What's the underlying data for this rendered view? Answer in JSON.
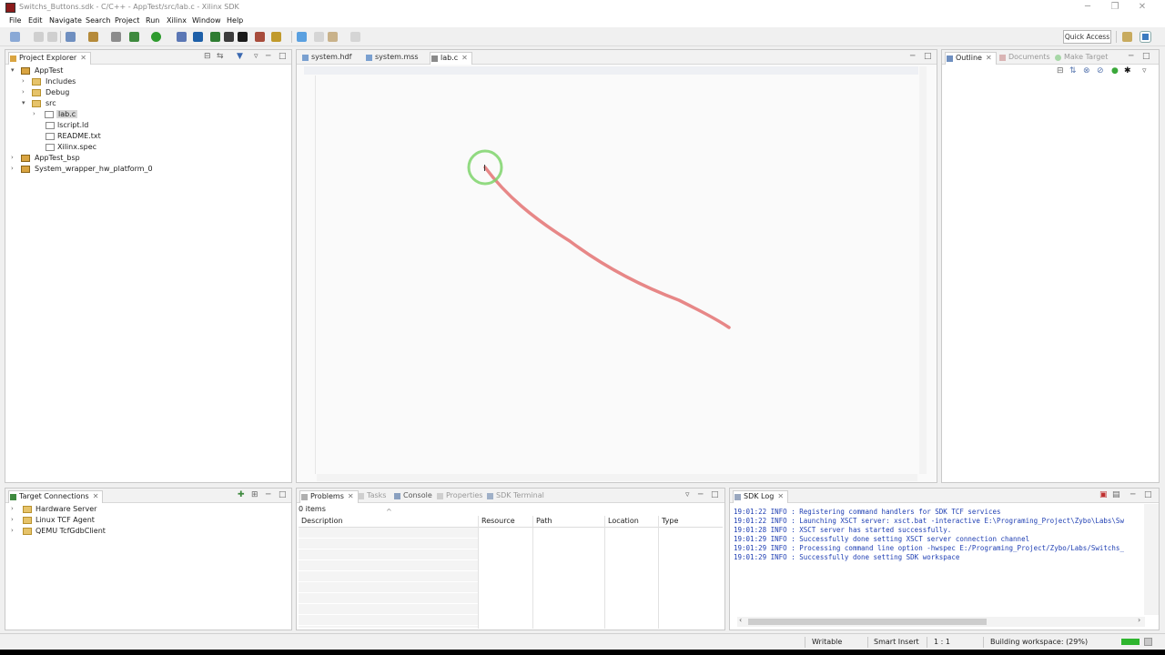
{
  "window": {
    "title": "Switchs_Buttons.sdk - C/C++ - AppTest/src/lab.c - Xilinx SDK",
    "controls": [
      "─",
      "❐",
      "✕"
    ]
  },
  "menu": [
    "File",
    "Edit",
    "Navigate",
    "Search",
    "Project",
    "Run",
    "Xilinx",
    "Window",
    "Help"
  ],
  "toolbar": {
    "quick_access": "Quick Access"
  },
  "project_explorer": {
    "title": "Project Explorer",
    "tree": {
      "apptest": "AppTest",
      "includes": "Includes",
      "debug": "Debug",
      "src": "src",
      "lab_c": "lab.c",
      "lscript": "lscript.ld",
      "readme": "README.txt",
      "xilinx_spec": "Xilinx.spec",
      "bsp": "AppTest_bsp",
      "hw_platform": "System_wrapper_hw_platform_0"
    }
  },
  "editor": {
    "tabs": [
      "system.hdf",
      "system.mss",
      "lab.c"
    ],
    "active_tab": "lab.c"
  },
  "outline": {
    "tabs": [
      "Outline",
      "Documents",
      "Make Target"
    ]
  },
  "target_connections": {
    "title": "Target Connections",
    "items": [
      "Hardware Server",
      "Linux TCF Agent",
      "QEMU TcfGdbClient"
    ]
  },
  "problems": {
    "tabs": [
      "Problems",
      "Tasks",
      "Console",
      "Properties",
      "SDK Terminal"
    ],
    "count": "0 items",
    "columns": [
      "Description",
      "Resource",
      "Path",
      "Location",
      "Type"
    ]
  },
  "sdk_log": {
    "title": "SDK Log",
    "lines": [
      "19:01:22 INFO   : Registering command handlers for SDK TCF services",
      "19:01:22 INFO   : Launching XSCT server: xsct.bat -interactive E:\\Programing_Project\\Zybo\\Labs\\Sw",
      "19:01:28 INFO   : XSCT server has started successfully.",
      "19:01:29 INFO   : Successfully done setting XSCT server connection channel",
      "19:01:29 INFO   : Processing command line option -hwspec E:/Programing_Project/Zybo/Labs/Switchs_",
      "19:01:29 INFO   : Successfully done setting SDK workspace"
    ]
  },
  "status": {
    "writable": "Writable",
    "insert_mode": "Smart Insert",
    "position": "1 : 1",
    "build": "Building workspace: (29%)"
  },
  "colors": {
    "annotation_stroke": "#e06060",
    "cursor_ring": "#7ed36b",
    "progress": "#2fb52f"
  }
}
